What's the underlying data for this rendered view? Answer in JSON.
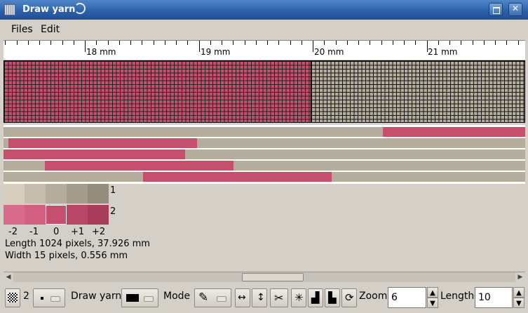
{
  "window": {
    "title": "Draw yarn"
  },
  "menu": [
    "Files",
    "Edit"
  ],
  "ruler": {
    "labels": [
      "18 mm",
      "19 mm",
      "20 mm",
      "21 mm"
    ]
  },
  "colors": {
    "pink": "#c4506e",
    "beige": "#b5ad9c",
    "title_bar": "#2a5fa8"
  },
  "palette": {
    "row_labels": [
      "1",
      "2"
    ],
    "shade_labels": [
      "-2",
      "-1",
      "0",
      "+1",
      "+2"
    ],
    "row1_colors": [
      "#d7cebe",
      "#c6bdac",
      "#b5ad9c",
      "#a59d8b",
      "#958d7b"
    ],
    "row2_colors": [
      "#d86a8c",
      "#d25e80",
      "#c4506e",
      "#b84865",
      "#a93e5a"
    ]
  },
  "info": {
    "length": "Length 1024 pixels, 37.926 mm",
    "width": "Width 15 pixels, 0.556 mm"
  },
  "toolbar": {
    "count": "2",
    "draw_yarn": "Draw yarn",
    "mode": "Mode",
    "zoom_label": "Zoom",
    "zoom_value": "6",
    "length_label": "Length",
    "length_value": "10"
  }
}
